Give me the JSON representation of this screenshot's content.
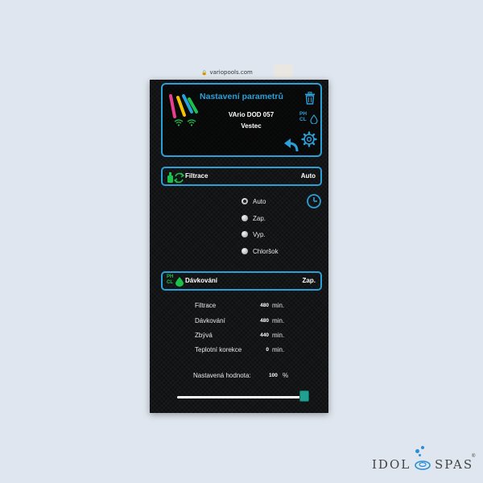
{
  "browser": {
    "url": "variopools.com"
  },
  "header": {
    "title": "Nastavení parametrů",
    "device_name": "VArio DOD 057",
    "location": "Vestec",
    "ph_label": "PH",
    "cl_label": "CL"
  },
  "filtrace": {
    "label": "Filtrace",
    "mode": "Auto",
    "options": [
      {
        "label": "Auto",
        "selected": true
      },
      {
        "label": "Zap.",
        "selected": false
      },
      {
        "label": "Vyp.",
        "selected": false
      },
      {
        "label": "Chloršok",
        "selected": false
      }
    ]
  },
  "davkovani": {
    "label": "Dávkování",
    "state": "Zap.",
    "ph_label": "PH",
    "cl_label": "CL"
  },
  "params": [
    {
      "label": "Filtrace",
      "value": "480",
      "unit": "min."
    },
    {
      "label": "Dávkování",
      "value": "480",
      "unit": "min."
    },
    {
      "label": "Zbývá",
      "value": "440",
      "unit": "min."
    },
    {
      "label": "Teplotní korekce",
      "value": "0",
      "unit": "min."
    }
  ],
  "setpoint": {
    "label": "Nastavená hodnota:",
    "value": "100",
    "unit": "%"
  },
  "slider": {
    "percent": 100
  },
  "brand": {
    "word1": "IDOL",
    "word2": "SPAS",
    "mark": "®"
  },
  "colors": {
    "accent": "#2aa0d8",
    "green": "#19c24b",
    "slider": "#1fa090"
  },
  "icons": [
    "lock-icon",
    "logo-stripes",
    "wifi-icon",
    "trash-icon",
    "ph-cl-icon",
    "gear-icon",
    "back-arrow-icon",
    "filtration-icon",
    "clock-icon",
    "dosing-icon"
  ]
}
